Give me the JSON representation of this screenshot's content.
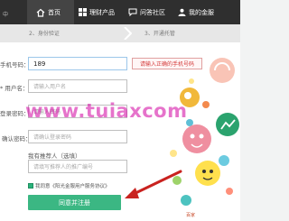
{
  "header": {
    "logo_text": "中",
    "nav": [
      {
        "label": "首页",
        "icon": "home-icon",
        "active": true
      },
      {
        "label": "理财产品",
        "icon": "grid-icon",
        "active": false
      },
      {
        "label": "问答社区",
        "icon": "chat-icon",
        "active": false
      },
      {
        "label": "我的金服",
        "icon": "user-icon",
        "active": false
      }
    ]
  },
  "steps": [
    {
      "label": "2、身份验证"
    },
    {
      "label": "3、开通托管"
    }
  ],
  "form": {
    "phone_label": "手机号码：",
    "phone_value": "189",
    "phone_error": "请输入正确的手机号码",
    "username_label": "* 用户名：",
    "username_placeholder": "请输入用户名",
    "password_label": "登录密码：",
    "password_placeholder": "请输入密码",
    "confirm_label": "确认密码：",
    "confirm_placeholder": "请确认登录密码",
    "referrer_label": "我有推荐人（选填）",
    "referrer_placeholder": "请填写推荐人的推广编号",
    "agree_label": "我同意《阳光金服用户服务协议》",
    "submit_label": "同意并注册"
  },
  "watermark": "www.tuiaxcom",
  "corner_logo": "百家",
  "colors": {
    "accent_green": "#3bb783",
    "error_red": "#d43c3c",
    "arrow_red": "#c9221f",
    "topbar": "#2f2f2f"
  }
}
